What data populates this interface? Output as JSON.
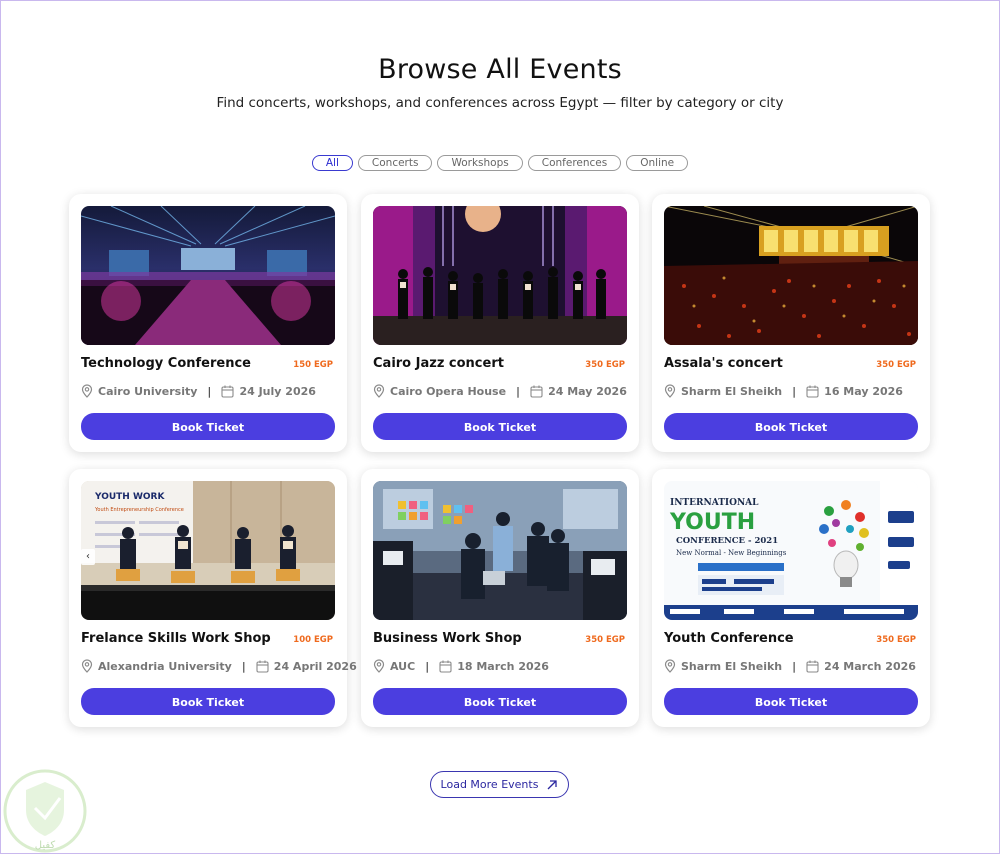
{
  "header": {
    "title": "Browse All Events",
    "subtitle": "Find concerts, workshops, and conferences across Egypt — filter by category or city"
  },
  "filters": [
    {
      "label": "All",
      "active": true
    },
    {
      "label": "Concerts",
      "active": false
    },
    {
      "label": "Workshops",
      "active": false
    },
    {
      "label": "Conferences",
      "active": false
    },
    {
      "label": "Online",
      "active": false
    }
  ],
  "events": [
    {
      "title": "Technology Conference",
      "price": "150 EGP",
      "location": "Cairo University",
      "date": "24 July 2026",
      "button": "Book Ticket"
    },
    {
      "title": "Cairo Jazz concert",
      "price": "350 EGP",
      "location": "Cairo Opera House",
      "date": "24 May 2026",
      "button": "Book Ticket"
    },
    {
      "title": "Assala's concert",
      "price": "350 EGP",
      "location": "Sharm El Sheikh",
      "date": "16 May 2026",
      "button": "Book Ticket"
    },
    {
      "title": "Frelance Skills Work Shop",
      "price": "100 EGP",
      "location": "Alexandria University",
      "date": "24 April 2026",
      "button": "Book Ticket"
    },
    {
      "title": "Business Work Shop",
      "price": "350 EGP",
      "location": "AUC",
      "date": "18 March 2026",
      "button": "Book Ticket"
    },
    {
      "title": "Youth Conference",
      "price": "350 EGP",
      "location": "Sharm El Sheikh",
      "date": "24 March 2026",
      "button": "Book Ticket"
    }
  ],
  "youth_poster": {
    "line1": "INTERNATIONAL",
    "line2": "YOUTH",
    "line3": "CONFERENCE - 2021",
    "line4": "New Normal - New Beginnings"
  },
  "workshop_poster": {
    "brand": "YOUTH WORK",
    "subtitle": "Youth Entrepreneurship Conference"
  },
  "load_more": {
    "label": "Load More Events"
  },
  "watermark": {
    "text": "كفيل"
  },
  "colors": {
    "accent": "#4b3ee0",
    "price": "#ef6a1e",
    "chip_active": "#3a3ad0"
  }
}
